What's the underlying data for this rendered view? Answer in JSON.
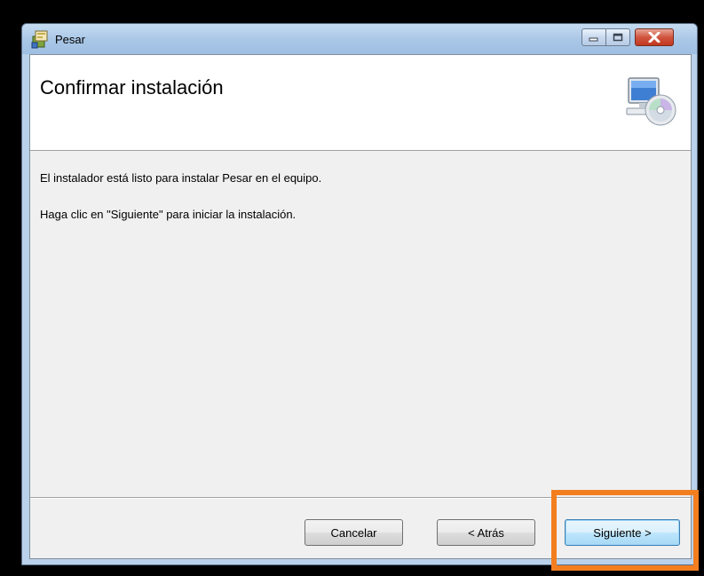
{
  "window": {
    "title": "Pesar",
    "app_icon": "installer-package-icon",
    "controls": {
      "minimize_icon": "minimize-icon",
      "maximize_icon": "maximize-icon",
      "close_icon": "close-icon"
    }
  },
  "header": {
    "title": "Confirmar instalación",
    "icon": "computer-cd-icon"
  },
  "body": {
    "line1": "El instalador está listo para instalar Pesar en el equipo.",
    "line2": "Haga clic en \"Siguiente\" para iniciar la instalación."
  },
  "buttons": {
    "cancel": "Cancelar",
    "back": "< Atrás",
    "next": "Siguiente >"
  },
  "colors": {
    "highlight": "#f37e20",
    "titlebar": "#b9d1ea",
    "close_button": "#c7432a"
  }
}
